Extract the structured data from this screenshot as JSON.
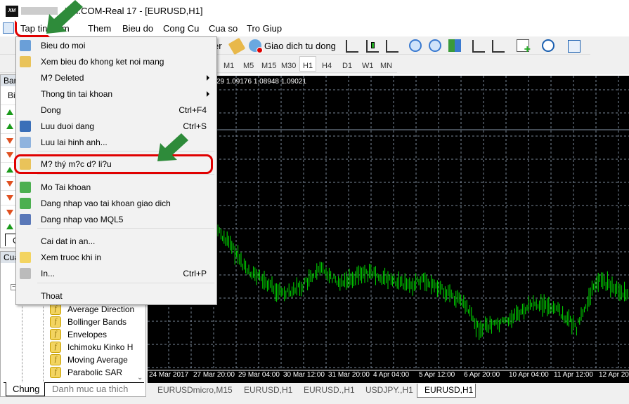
{
  "window": {
    "title": "XM.COM-Real 17 - [EURUSD,H1]",
    "logo_text": "XM"
  },
  "menubar": [
    "Tap tin",
    "Xem",
    "Them",
    "Bieu do",
    "Cong Cu",
    "Cua so",
    "Tro Giup"
  ],
  "toolbar": {
    "trader_label": "er",
    "auto_trading": "Giao dich tu dong"
  },
  "timeframes": [
    "M1",
    "M5",
    "M15",
    "M30",
    "H1",
    "H4",
    "D1",
    "W1",
    "MN"
  ],
  "selected_timeframe": "H1",
  "chart": {
    "ohlc_info": "29 1.09176 1.08948 1.09021",
    "time_labels": [
      "24 Mar 2017",
      "27 Mar 20:00",
      "29 Mar 04:00",
      "30 Mar 12:00",
      "31 Mar 20:00",
      "4 Apr 04:00",
      "5 Apr 12:00",
      "6 Apr 20:00",
      "10 Apr 04:00",
      "11 Apr 12:00",
      "12 Apr 20:00"
    ],
    "bar_color": "#00e000",
    "background": "#000000"
  },
  "chart_tabs": [
    "EURUSDmicro,M15",
    "EURUSD,H1",
    "EURUSD.,H1",
    "USDJPY.,H1",
    "EURUSD,H1"
  ],
  "active_chart_tab": "EURUSD,H1",
  "market_watch": {
    "title": "Bar",
    "column": "Bi",
    "tab": "C",
    "directions": [
      "up",
      "up",
      "down",
      "down",
      "up",
      "down",
      "down",
      "down",
      "up"
    ]
  },
  "navigator": {
    "title": "Cua",
    "indicators": [
      "Average Direction",
      "Bollinger Bands",
      "Envelopes",
      "Ichimoku Kinko H",
      "Moving Average",
      "Parabolic SAR"
    ],
    "tabs": [
      "Chung",
      "Danh muc ua thich"
    ]
  },
  "file_menu": {
    "items": [
      {
        "label": "Bieu do moi",
        "icon": "new-chart-icon"
      },
      {
        "label": "Xem bieu đo khong ket noi mang",
        "icon": "open-offline-icon"
      },
      {
        "label": "M? Deleted",
        "submenu": true
      },
      {
        "label": "Thong tin tai khoan",
        "submenu": true
      },
      {
        "label": "Dong",
        "shortcut": "Ctrl+F4"
      },
      {
        "label": "Luu duoi dang",
        "shortcut": "Ctrl+S",
        "icon": "save-icon"
      },
      {
        "label": "Luu lai hinh anh...",
        "icon": "save-picture-icon"
      },
      {
        "label": "M? thý m?c d? li?u",
        "icon": "folder-icon",
        "highlighted": true
      },
      {
        "label": "Mo Tai khoan",
        "icon": "open-account-icon"
      },
      {
        "label": "Dang nhap vao tai khoan giao dich",
        "icon": "login-icon"
      },
      {
        "label": "Dang nhap vao MQL5",
        "icon": "mql5-login-icon"
      },
      {
        "label": "Cai dat in an..."
      },
      {
        "label": "Xem truoc khi in",
        "icon": "print-preview-icon"
      },
      {
        "label": "In...",
        "shortcut": "Ctrl+P",
        "icon": "print-icon"
      },
      {
        "label": "Thoat"
      }
    ]
  },
  "annotation_colors": {
    "highlight": "#e00000",
    "arrow": "#2e8b3a"
  }
}
